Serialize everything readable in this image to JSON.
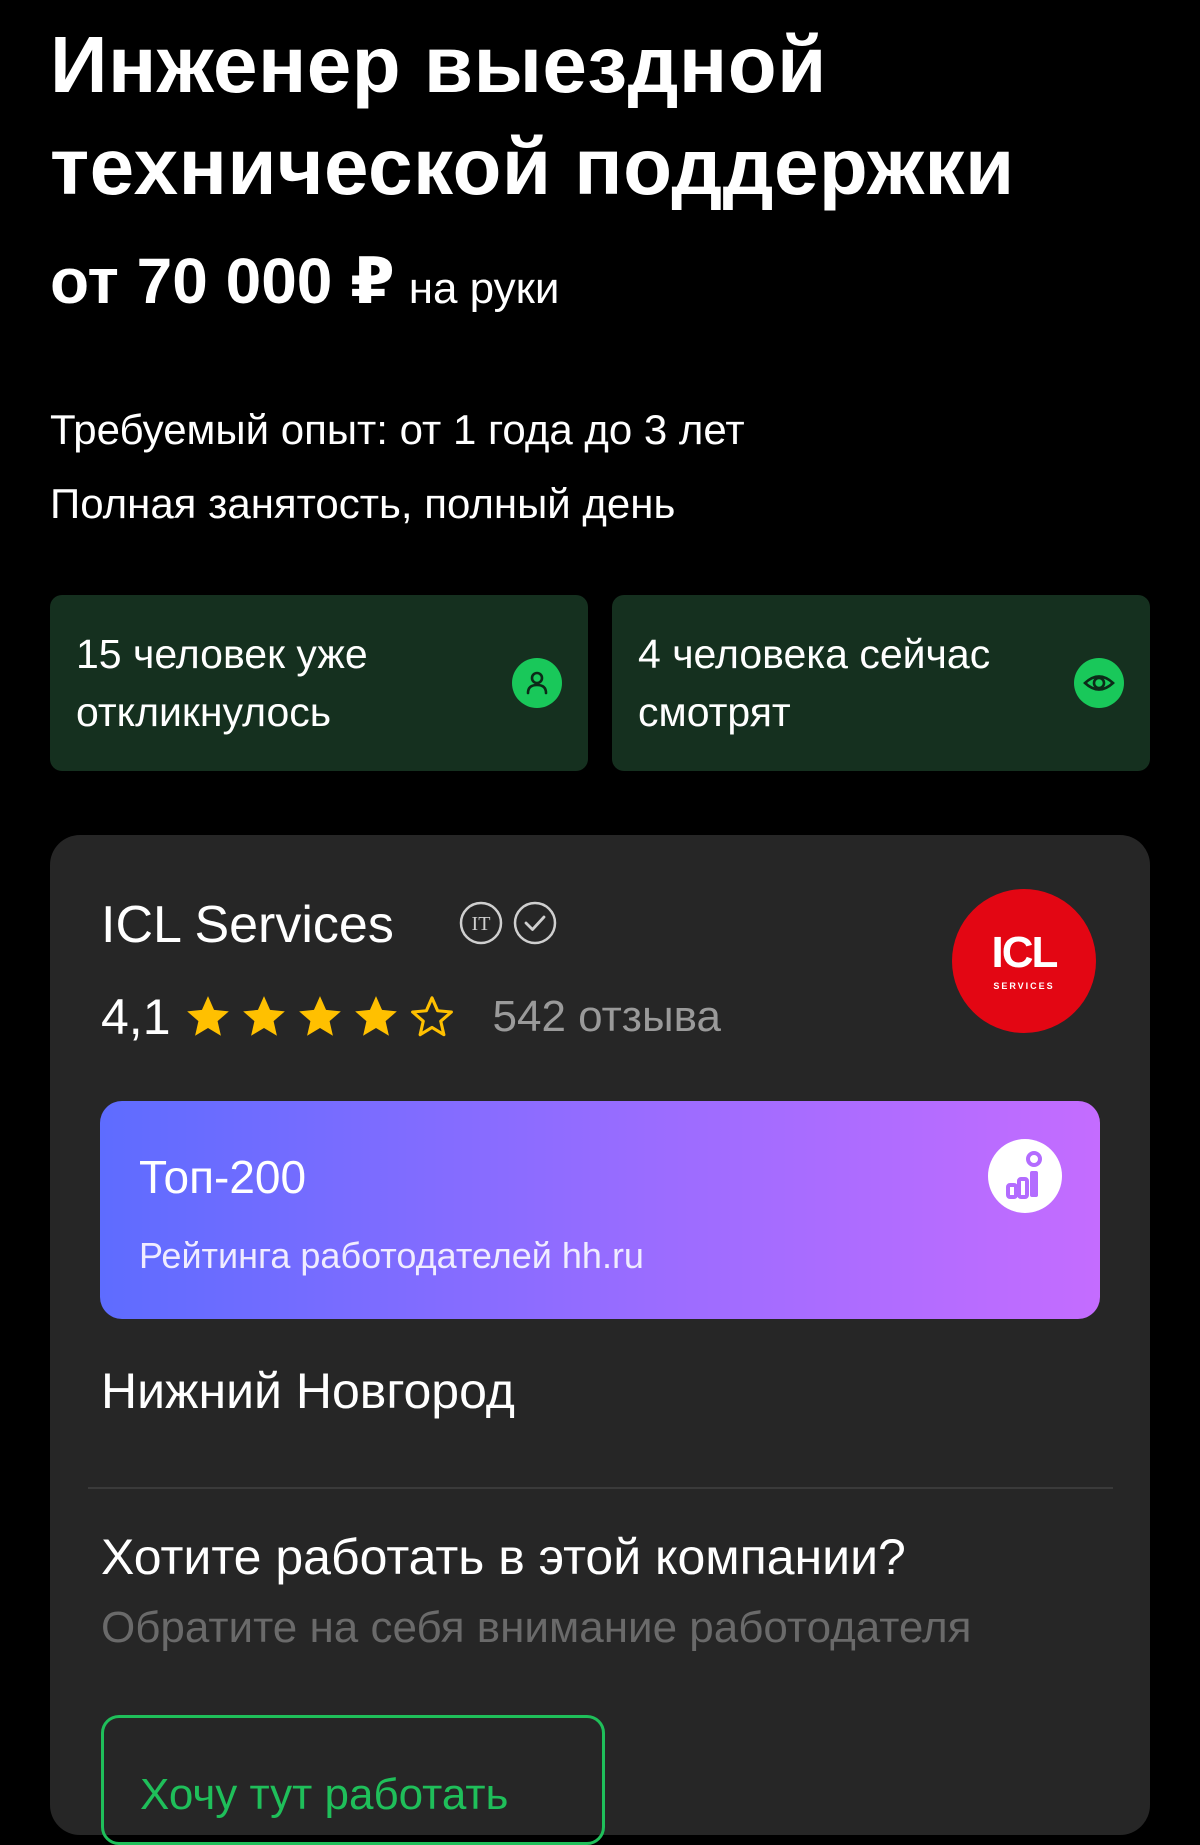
{
  "vacancy": {
    "title": "Инженер выездной технической поддержки",
    "salary_amount": "от 70 000 ₽",
    "salary_note": "на руки",
    "experience": "Требуемый опыт: от 1 года до 3 лет",
    "employment": "Полная занятость, полный день"
  },
  "stats": [
    {
      "text": "15 человек уже откликнулось",
      "icon": "person-icon"
    },
    {
      "text": "4 человека сейчас смотрят",
      "icon": "eye-icon"
    }
  ],
  "company": {
    "name": "ICL Services",
    "badge_it": "IT",
    "logo_main": "ICL",
    "logo_sub": "SERVICES",
    "rating": "4,1",
    "rating_value": 4.1,
    "stars_filled": 4,
    "stars_total": 5,
    "reviews": "542 отзыва",
    "city": "Нижний Новгород"
  },
  "top_banner": {
    "title": "Топ-200",
    "subtitle": "Рейтинга работодателей hh.ru"
  },
  "cta": {
    "title": "Хотите работать в этой компании?",
    "subtitle": "Обратите на себя внимание работодателя",
    "button_label": "Хочу тут работать"
  },
  "colors": {
    "background": "#000000",
    "stat_card": "#15301f",
    "accent_green": "#1fbf5a",
    "card": "#262626",
    "star": "#ffc000",
    "logo_red": "#e30613"
  }
}
